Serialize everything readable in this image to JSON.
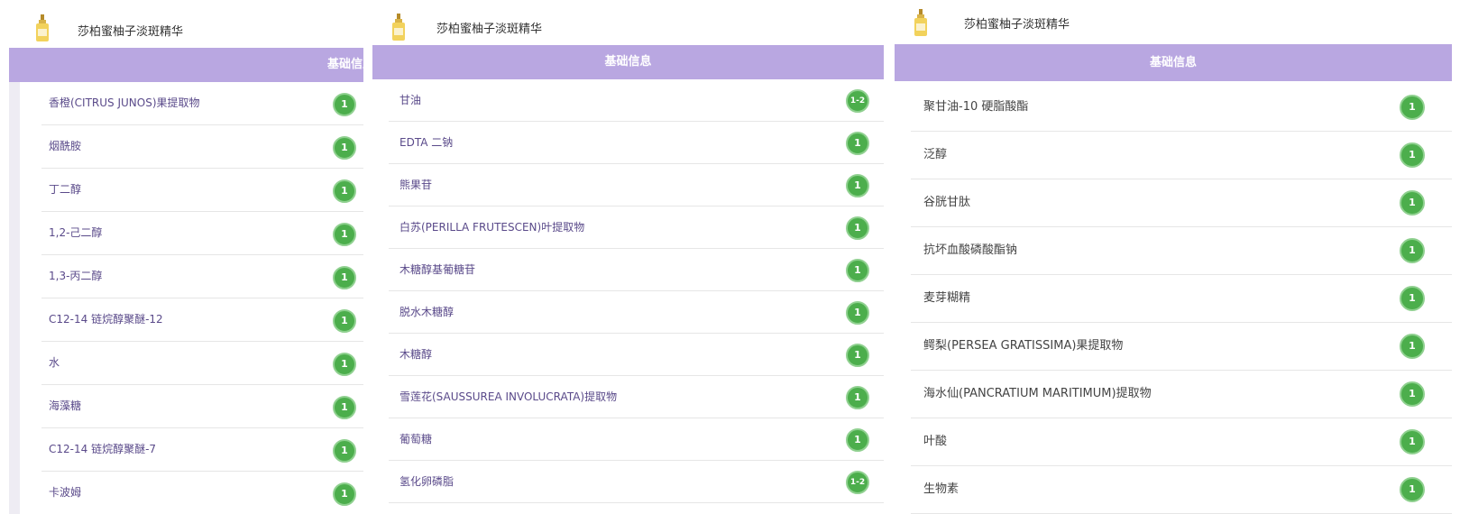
{
  "panels": [
    {
      "product_title": "莎柏蜜柚子淡斑精华",
      "section_label": "基础信息",
      "items": [
        {
          "name": "香橙(CITRUS JUNOS)果提取物",
          "badge": "1"
        },
        {
          "name": "烟酰胺",
          "badge": "1"
        },
        {
          "name": "丁二醇",
          "badge": "1"
        },
        {
          "name": "1,2-己二醇",
          "badge": "1"
        },
        {
          "name": "1,3-丙二醇",
          "badge": "1"
        },
        {
          "name": "C12-14 链烷醇聚醚-12",
          "badge": "1"
        },
        {
          "name": "水",
          "badge": "1"
        },
        {
          "name": "海藻糖",
          "badge": "1"
        },
        {
          "name": "C12-14 链烷醇聚醚-7",
          "badge": "1"
        },
        {
          "name": "卡波姆",
          "badge": "1"
        }
      ]
    },
    {
      "product_title": "莎柏蜜柚子淡斑精华",
      "section_label": "基础信息",
      "items": [
        {
          "name": "甘油",
          "badge": "1-2"
        },
        {
          "name": "EDTA 二钠",
          "badge": "1"
        },
        {
          "name": "熊果苷",
          "badge": "1"
        },
        {
          "name": "白苏(PERILLA FRUTESCEN)叶提取物",
          "badge": "1"
        },
        {
          "name": "木糖醇基葡糖苷",
          "badge": "1"
        },
        {
          "name": "脱水木糖醇",
          "badge": "1"
        },
        {
          "name": "木糖醇",
          "badge": "1"
        },
        {
          "name": "雪莲花(SAUSSUREA INVOLUCRATA)提取物",
          "badge": "1"
        },
        {
          "name": "葡萄糖",
          "badge": "1"
        },
        {
          "name": "氢化卵磷脂",
          "badge": "1-2"
        }
      ]
    },
    {
      "product_title": "莎柏蜜柚子淡斑精华",
      "section_label": "基础信息",
      "items": [
        {
          "name": "聚甘油-10 硬脂酸酯",
          "badge": "1"
        },
        {
          "name": "泛醇",
          "badge": "1"
        },
        {
          "name": "谷胱甘肽",
          "badge": "1"
        },
        {
          "name": "抗坏血酸磷酸酯钠",
          "badge": "1"
        },
        {
          "name": "麦芽糊精",
          "badge": "1"
        },
        {
          "name": "鳄梨(PERSEA GRATISSIMA)果提取物",
          "badge": "1"
        },
        {
          "name": "海水仙(PANCRATIUM MARITIMUM)提取物",
          "badge": "1"
        },
        {
          "name": "叶酸",
          "badge": "1"
        },
        {
          "name": "生物素",
          "badge": "1"
        }
      ]
    }
  ],
  "colors": {
    "section_bar": "#b9a7e1",
    "badge": "#4cae4c",
    "item_text": "#5a4a8a"
  },
  "icons": {
    "product_logo": "serum-bottle-icon"
  }
}
